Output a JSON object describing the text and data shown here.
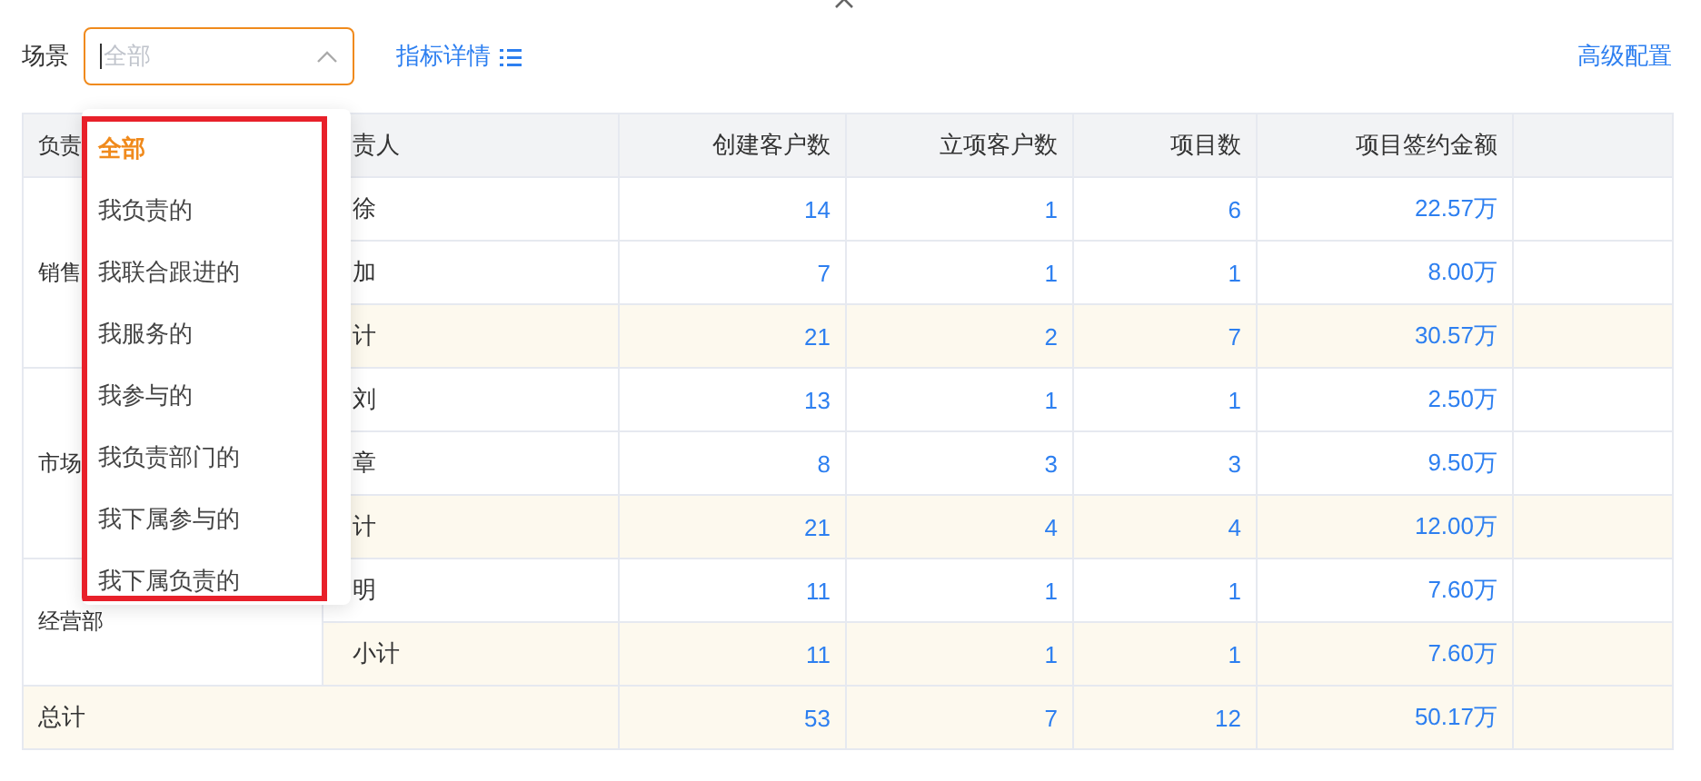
{
  "toolbar": {
    "scene_label": "场景",
    "scene_select": {
      "placeholder": "全部",
      "expanded": true
    },
    "metric_link": "指标详情",
    "advanced_link": "高级配置"
  },
  "dropdown": {
    "options": [
      {
        "label": "全部",
        "selected": true
      },
      {
        "label": "我负责的",
        "selected": false
      },
      {
        "label": "我联合跟进的",
        "selected": false
      },
      {
        "label": "我服务的",
        "selected": false
      },
      {
        "label": "我参与的",
        "selected": false
      },
      {
        "label": "我负责部门的",
        "selected": false
      },
      {
        "label": "我下属参与的",
        "selected": false
      },
      {
        "label": "我下属负责的",
        "selected": false
      }
    ]
  },
  "table": {
    "columns": [
      "负责",
      "责人",
      "创建客户数",
      "立项客户数",
      "项目数",
      "项目签约金额"
    ],
    "groups": [
      {
        "name": "销售",
        "rows": [
          {
            "kind": "person",
            "name": "徐",
            "values": [
              "14",
              "1",
              "6",
              "22.57万"
            ]
          },
          {
            "kind": "person",
            "name": "加",
            "values": [
              "7",
              "1",
              "1",
              "8.00万"
            ]
          },
          {
            "kind": "subtotal",
            "name": "计",
            "values": [
              "21",
              "2",
              "7",
              "30.57万"
            ]
          }
        ]
      },
      {
        "name": "市场",
        "rows": [
          {
            "kind": "person",
            "name": "刘",
            "values": [
              "13",
              "1",
              "1",
              "2.50万"
            ]
          },
          {
            "kind": "person",
            "name": "章",
            "values": [
              "8",
              "3",
              "3",
              "9.50万"
            ]
          },
          {
            "kind": "subtotal",
            "name": "计",
            "values": [
              "21",
              "4",
              "4",
              "12.00万"
            ]
          }
        ]
      },
      {
        "name": "经营部",
        "rows": [
          {
            "kind": "person",
            "name": "明",
            "values": [
              "11",
              "1",
              "1",
              "7.60万"
            ]
          },
          {
            "kind": "subtotal",
            "name": "小计",
            "values": [
              "11",
              "1",
              "1",
              "7.60万"
            ]
          }
        ]
      }
    ],
    "total": {
      "label": "总计",
      "values": [
        "53",
        "7",
        "12",
        "50.17万"
      ]
    }
  }
}
